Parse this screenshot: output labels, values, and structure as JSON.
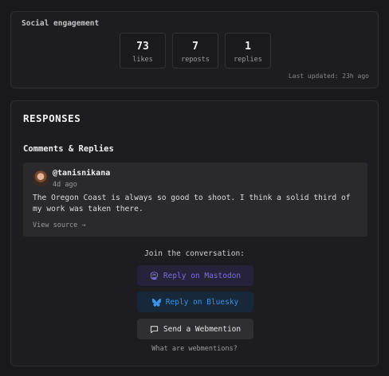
{
  "engagement": {
    "title": "Social engagement",
    "stats": [
      {
        "value": "73",
        "label": "likes"
      },
      {
        "value": "7",
        "label": "reposts"
      },
      {
        "value": "1",
        "label": "replies"
      }
    ],
    "updated": "Last updated: 23h ago"
  },
  "responses": {
    "title": "RESPONSES",
    "subtitle": "Comments & Replies",
    "comments": [
      {
        "author": "@tanisnikana",
        "time": "4d ago",
        "text": "The Oregon Coast is always so good to shoot. I think a solid third of my work was taken there.",
        "source_label": "View source →"
      }
    ],
    "join_label": "Join the conversation:",
    "buttons": {
      "mastodon": "Reply on Mastodon",
      "bluesky": "Reply on Bluesky",
      "webmention": "Send a Webmention"
    },
    "what_label": "What are webmentions?"
  },
  "colors": {
    "mastodon": "#7d6ee0",
    "bluesky": "#3d93e8",
    "background": "#19191d"
  },
  "icons": [
    "mastodon-icon",
    "bluesky-icon",
    "speech-bubble-icon"
  ]
}
